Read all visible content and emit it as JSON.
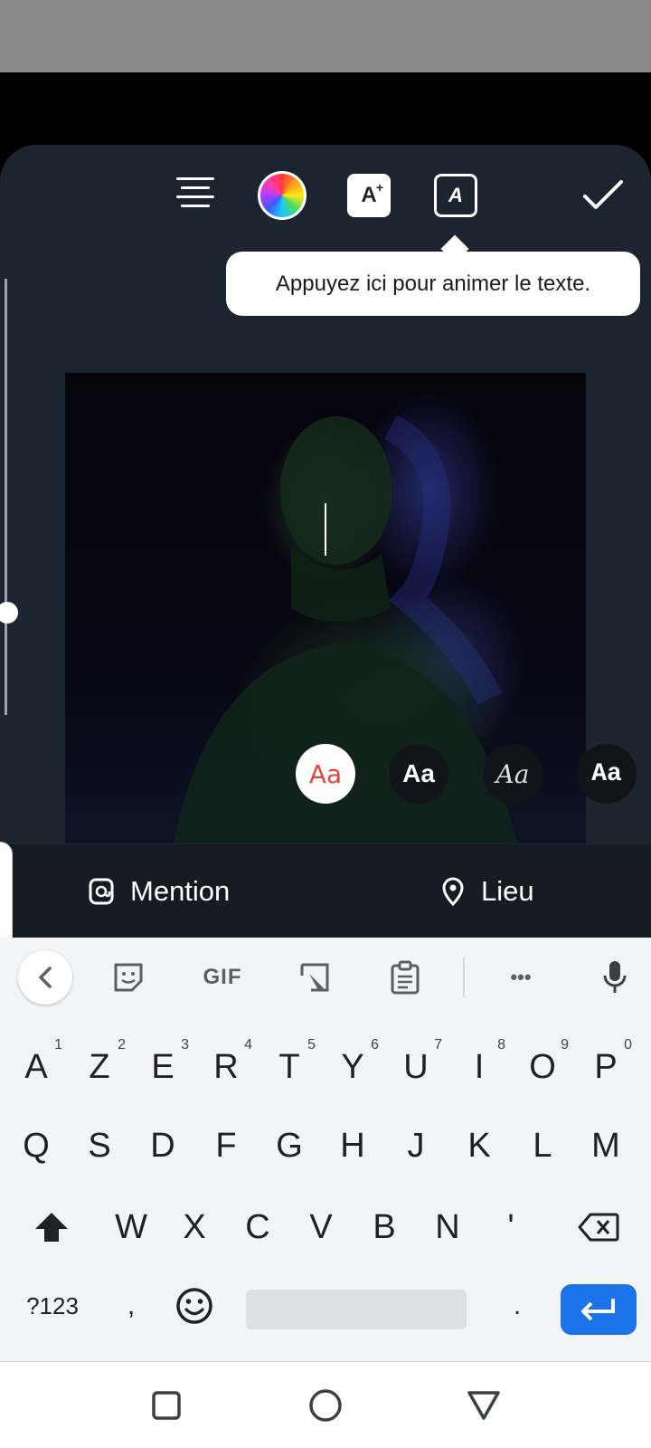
{
  "toolbar": {
    "align_icon": "align-center-icon",
    "color_icon": "color-wheel-icon",
    "effect_icon": "text-effect-icon",
    "effect_label": "A",
    "effect_sparkle": "+",
    "animate_icon": "animate-text-icon",
    "animate_label": "A",
    "done_icon": "checkmark-icon"
  },
  "tooltip": {
    "text": "Appuyez ici pour animer le texte."
  },
  "font_styles": [
    {
      "label": "Aa",
      "style": "classic",
      "selected": true
    },
    {
      "label": "Aa",
      "style": "modern"
    },
    {
      "label": "Aa",
      "style": "script"
    },
    {
      "label": "Aa",
      "style": "typewriter"
    }
  ],
  "tags": {
    "mention_label": "Mention",
    "location_label": "Lieu"
  },
  "keyboard": {
    "toolbar": {
      "gif_label": "GIF",
      "more_label": "•••"
    },
    "row1": [
      {
        "k": "A",
        "n": "1"
      },
      {
        "k": "Z",
        "n": "2"
      },
      {
        "k": "E",
        "n": "3"
      },
      {
        "k": "R",
        "n": "4"
      },
      {
        "k": "T",
        "n": "5"
      },
      {
        "k": "Y",
        "n": "6"
      },
      {
        "k": "U",
        "n": "7"
      },
      {
        "k": "I",
        "n": "8"
      },
      {
        "k": "O",
        "n": "9"
      },
      {
        "k": "P",
        "n": "0"
      }
    ],
    "row2": [
      "Q",
      "S",
      "D",
      "F",
      "G",
      "H",
      "J",
      "K",
      "L",
      "M"
    ],
    "row3": [
      "W",
      "X",
      "C",
      "V",
      "B",
      "N",
      "'"
    ],
    "symbols_label": "?123",
    "comma_label": ",",
    "period_label": "."
  },
  "colors": {
    "accent_blue": "#1a73e8",
    "sheet_bg": "#1c2430",
    "selected_font_red": "#e2453b"
  }
}
